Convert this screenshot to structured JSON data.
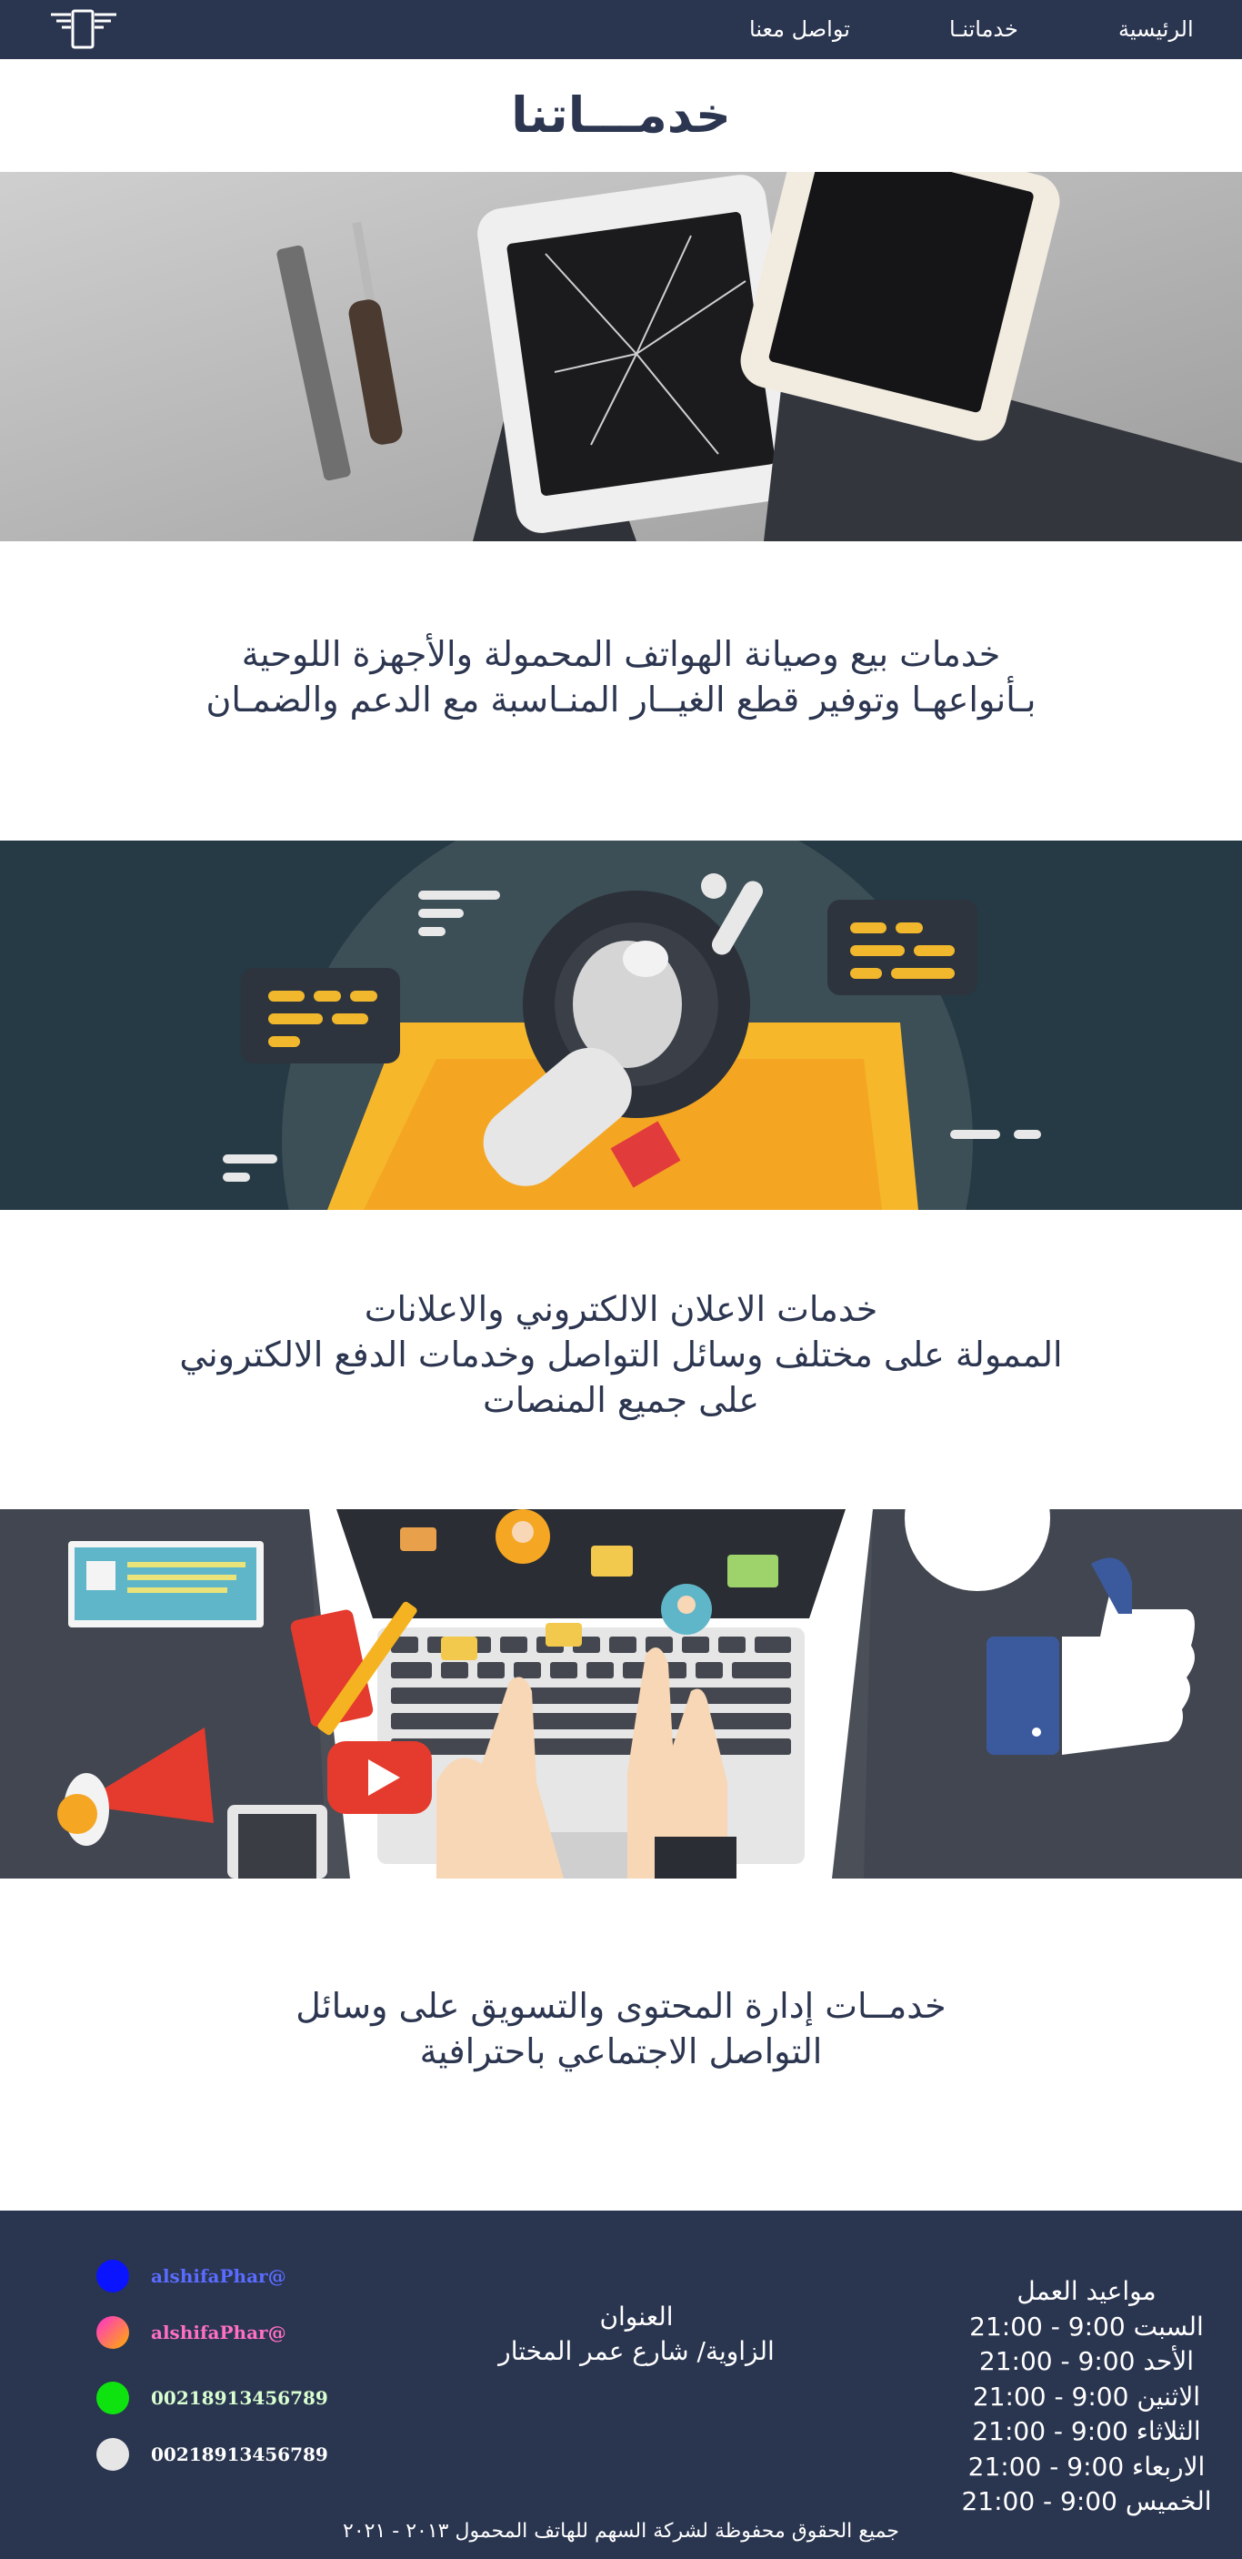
{
  "nav": {
    "home": "الرئيسية",
    "services": "خدماتنـا",
    "contact": "تواصل معنا"
  },
  "page_title": "خدمـــاتنا",
  "services": [
    {
      "image": "phone-repair-photo",
      "lines": [
        "خدمات بيع وصيانة الهواتف المحمولة والأجهزة اللوحية",
        "بـأنواعهـا وتوفير قطع الغيــار المنـاسبة مع الدعم والضمـان"
      ]
    },
    {
      "image": "megaphone-marketing-illustration",
      "lines": [
        "خدمات الاعلان الالكتروني والاعلانات",
        "الممولة على مختلف وسائل التواصل وخدمات الدفع الالكتروني",
        "على جميع المنصات"
      ]
    },
    {
      "image": "social-media-laptop-illustration",
      "lines": [
        "خدمــات إدارة المحتوى والتسويق على وسائل",
        "التواصل الاجتماعي باحترافية"
      ]
    }
  ],
  "footer": {
    "contacts": [
      {
        "text": "alshifaPhar@",
        "color": "#0a14ff",
        "text_color": "#5a6cff",
        "icon": "facebook-icon"
      },
      {
        "text": "alshifaPhar@",
        "color": "#ff2fae",
        "text_color": "#ff6fc4",
        "icon": "instagram-icon"
      },
      {
        "text": "00218913456789",
        "color": "#0fe30f",
        "text_color": "#d8ffd0",
        "icon": "whatsapp-icon"
      },
      {
        "text": "00218913456789",
        "color": "#e6e6e6",
        "text_color": "#ffffff",
        "icon": "phone-icon"
      }
    ],
    "address_title": "العنوان",
    "address": "الزاوية/ شارع عمر المختار",
    "hours_title": "مواعيد العمل",
    "hours": [
      "السبت 9:00 - 21:00",
      "الأحد 9:00 - 21:00",
      "الاثنين 9:00 - 21:00",
      "الثلاثاء 9:00 - 21:00",
      "الاربعاء 9:00 - 21:00",
      "الخميس 9:00 - 21:00"
    ],
    "copyright": "جميع الحقوق محفوظة لشركة السهم للهاتف المحمول ٢٠١٣ - ٢٠٢١"
  }
}
